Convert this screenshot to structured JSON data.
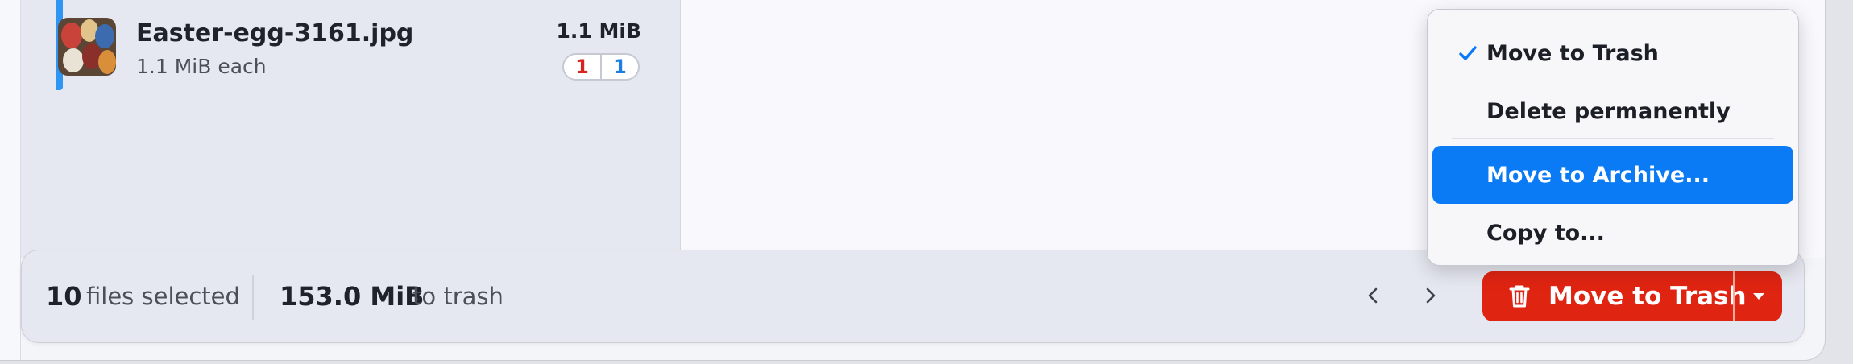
{
  "file_list": {
    "items": [
      {
        "name": "Easter-egg-3161.jpg",
        "subtitle": "1.1 MiB each",
        "size": "1.1 MiB",
        "badge_red": "1",
        "badge_blue": "1"
      }
    ]
  },
  "bottom_bar": {
    "selected_count": "10",
    "selected_label": "files selected",
    "total_size": "153.0 MiB",
    "total_size_label": "to trash",
    "action_label": "Move to Trash"
  },
  "menu": {
    "items": [
      {
        "label": "Move to Trash",
        "checked": true
      },
      {
        "label": "Delete permanently",
        "checked": false
      },
      {
        "label": "Move to Archive...",
        "highlighted": true
      },
      {
        "label": "Copy to..."
      }
    ]
  },
  "colors": {
    "accent_blue": "#0a7bf4",
    "danger_red": "#e02412",
    "badge_red": "#d82323",
    "badge_blue": "#1d7fe0"
  },
  "icons": {
    "thumbnail": "easter-eggs-photo",
    "trash": "trash-icon",
    "dropdown": "caret-down-icon",
    "previous": "chevron-left-icon",
    "next": "chevron-right-icon",
    "check": "checkmark-icon"
  }
}
